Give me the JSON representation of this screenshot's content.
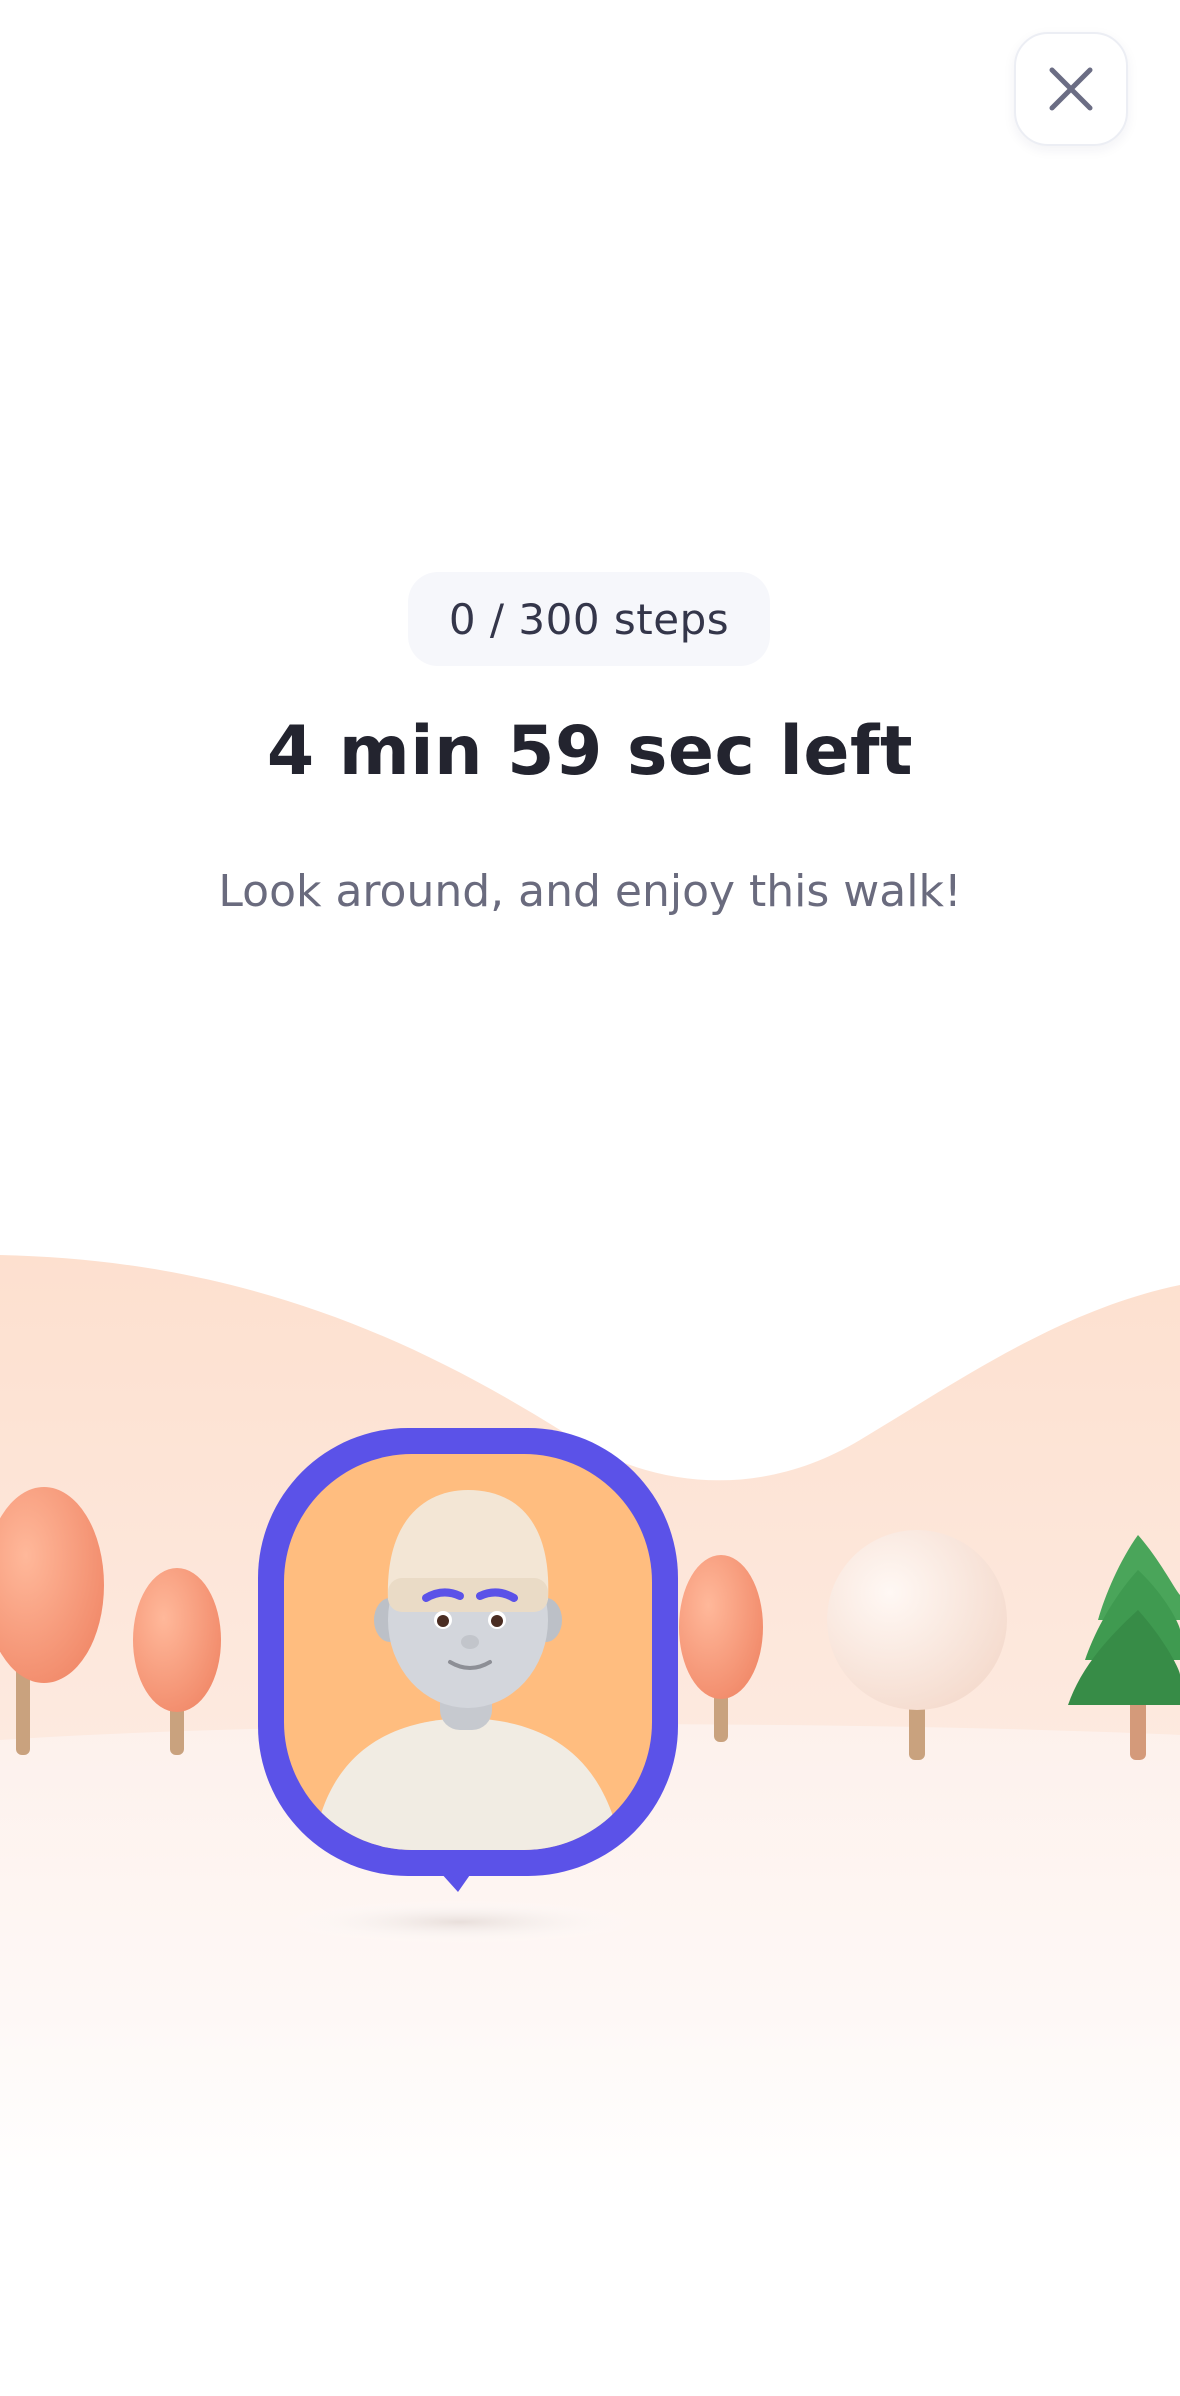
{
  "header": {
    "close_icon": "close-icon"
  },
  "walk": {
    "steps_text": "0 / 300 steps",
    "time_left": "4 min 59 sec left",
    "message": "Look around, and enjoy this walk!"
  },
  "scene": {
    "avatar_frame_color": "#5b52e8",
    "avatar_bg_color": "#ffbd7f",
    "hill_color": "#fde2d2"
  }
}
